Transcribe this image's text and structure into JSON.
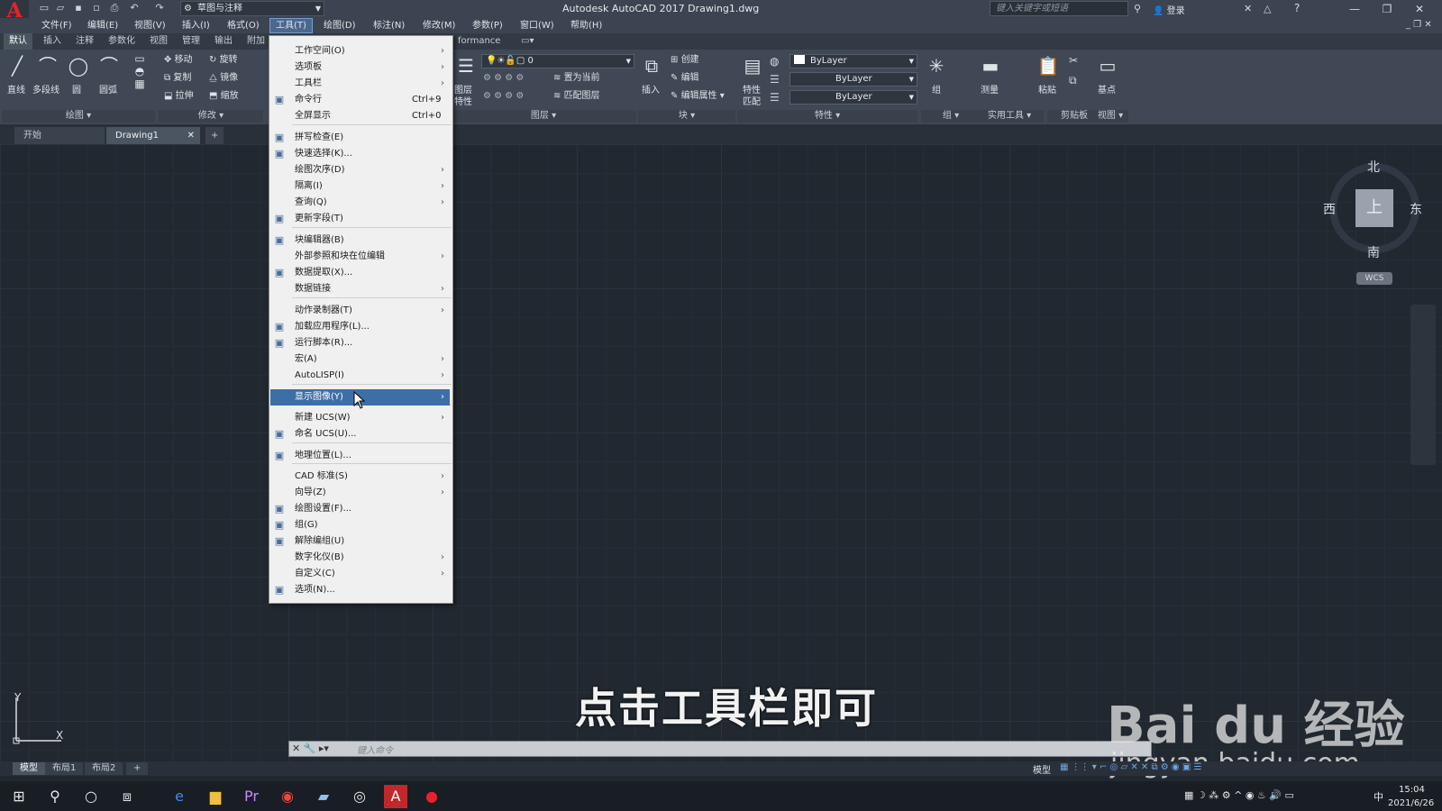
{
  "titlebar": {
    "logo": "A",
    "workspace": "草图与注释",
    "app_title": "Autodesk AutoCAD 2017    Drawing1.dwg",
    "search_placeholder": "键入关键字或短语",
    "signin": "登录"
  },
  "menubar": [
    "文件(F)",
    "编辑(E)",
    "视图(V)",
    "插入(I)",
    "格式(O)",
    "工具(T)",
    "绘图(D)",
    "标注(N)",
    "修改(M)",
    "参数(P)",
    "窗口(W)",
    "帮助(H)"
  ],
  "ribbon_tabs": [
    "默认",
    "插入",
    "注释",
    "参数化",
    "视图",
    "管理",
    "输出",
    "附加"
  ],
  "ribbon_tab_fragment": "formance",
  "ribbon": {
    "draw": {
      "line": "直线",
      "polyline": "多段线",
      "circle": "圆",
      "arc": "圆弧",
      "title": "绘图"
    },
    "modify": {
      "move": "移动",
      "rotate": "旋转",
      "copy": "复制",
      "mirror": "镜像",
      "stretch": "拉伸",
      "scale": "缩放",
      "title": "修改"
    },
    "layers": {
      "props_line1": "图层",
      "props_line2": "特性",
      "current_layer": "0",
      "set_current": "置为当前",
      "match_layer": "匹配图层",
      "title": "图层"
    },
    "block": {
      "insert": "插入",
      "create": "创建",
      "edit": "编辑",
      "edit_attr": "编辑属性",
      "title": "块"
    },
    "properties": {
      "match_line1": "特性",
      "match_line2": "匹配",
      "color": "ByLayer",
      "linetype": "ByLayer",
      "lineweight": "ByLayer",
      "title": "特性"
    },
    "groups": {
      "group": "组",
      "title": "组"
    },
    "utilities": {
      "measure": "测量",
      "title": "实用工具"
    },
    "clipboard": {
      "paste": "粘贴",
      "title": "剪贴板"
    },
    "view": {
      "base": "基点",
      "title": "视图"
    }
  },
  "doc_tabs": [
    "开始",
    "Drawing1"
  ],
  "viewcube": {
    "north": "北",
    "south": "南",
    "east": "东",
    "west": "西",
    "top": "上",
    "wcs": "WCS"
  },
  "ucs": {
    "x": "X",
    "y": "Y"
  },
  "command_line": {
    "placeholder": "键入命令"
  },
  "caption": "点击工具栏即可",
  "watermark": {
    "logo": "Bai du 经验",
    "url": "jingyan.baidu.com"
  },
  "layout_tabs": [
    "模型",
    "布局1",
    "布局2"
  ],
  "status": {
    "model": "模型"
  },
  "clock": {
    "time": "15:04",
    "date": "2021/6/26"
  },
  "tray_ime": "中",
  "tools_menu": {
    "items": [
      {
        "label": "工作空间(O)",
        "sub": true
      },
      {
        "label": "选项板",
        "sub": true
      },
      {
        "label": "工具栏",
        "sub": true
      },
      {
        "label": "命令行",
        "shortcut": "Ctrl+9",
        "icon": "command-line-icon"
      },
      {
        "label": "全屏显示",
        "shortcut": "Ctrl+0"
      },
      {
        "label": "拼写检查(E)",
        "icon": "spell-check-icon"
      },
      {
        "label": "快速选择(K)...",
        "icon": "quick-select-icon"
      },
      {
        "label": "绘图次序(D)",
        "sub": true
      },
      {
        "label": "隔离(I)",
        "sub": true
      },
      {
        "label": "查询(Q)",
        "sub": true
      },
      {
        "label": "更新字段(T)",
        "icon": "update-field-icon"
      },
      {
        "label": "块编辑器(B)",
        "icon": "block-editor-icon"
      },
      {
        "label": "外部参照和块在位编辑",
        "sub": true
      },
      {
        "label": "数据提取(X)...",
        "icon": "data-extraction-icon"
      },
      {
        "label": "数据链接",
        "sub": true
      },
      {
        "label": "动作录制器(T)",
        "sub": true
      },
      {
        "label": "加载应用程序(L)...",
        "icon": "load-app-icon"
      },
      {
        "label": "运行脚本(R)...",
        "icon": "run-script-icon"
      },
      {
        "label": "宏(A)",
        "sub": true
      },
      {
        "label": "AutoLISP(I)",
        "sub": true
      },
      {
        "label": "显示图像(Y)",
        "sub": true,
        "highlighted": true
      },
      {
        "label": "新建 UCS(W)",
        "sub": true
      },
      {
        "label": "命名 UCS(U)...",
        "icon": "named-ucs-icon"
      },
      {
        "label": "地理位置(L)...",
        "icon": "geolocation-icon"
      },
      {
        "label": "CAD 标准(S)",
        "sub": true
      },
      {
        "label": "向导(Z)",
        "sub": true
      },
      {
        "label": "绘图设置(F)...",
        "icon": "drafting-settings-icon"
      },
      {
        "label": "组(G)",
        "icon": "group-icon"
      },
      {
        "label": "解除编组(U)",
        "icon": "ungroup-icon"
      },
      {
        "label": "数字化仪(B)",
        "sub": true
      },
      {
        "label": "自定义(C)",
        "sub": true
      },
      {
        "label": "选项(N)...",
        "icon": "options-icon"
      }
    ]
  }
}
